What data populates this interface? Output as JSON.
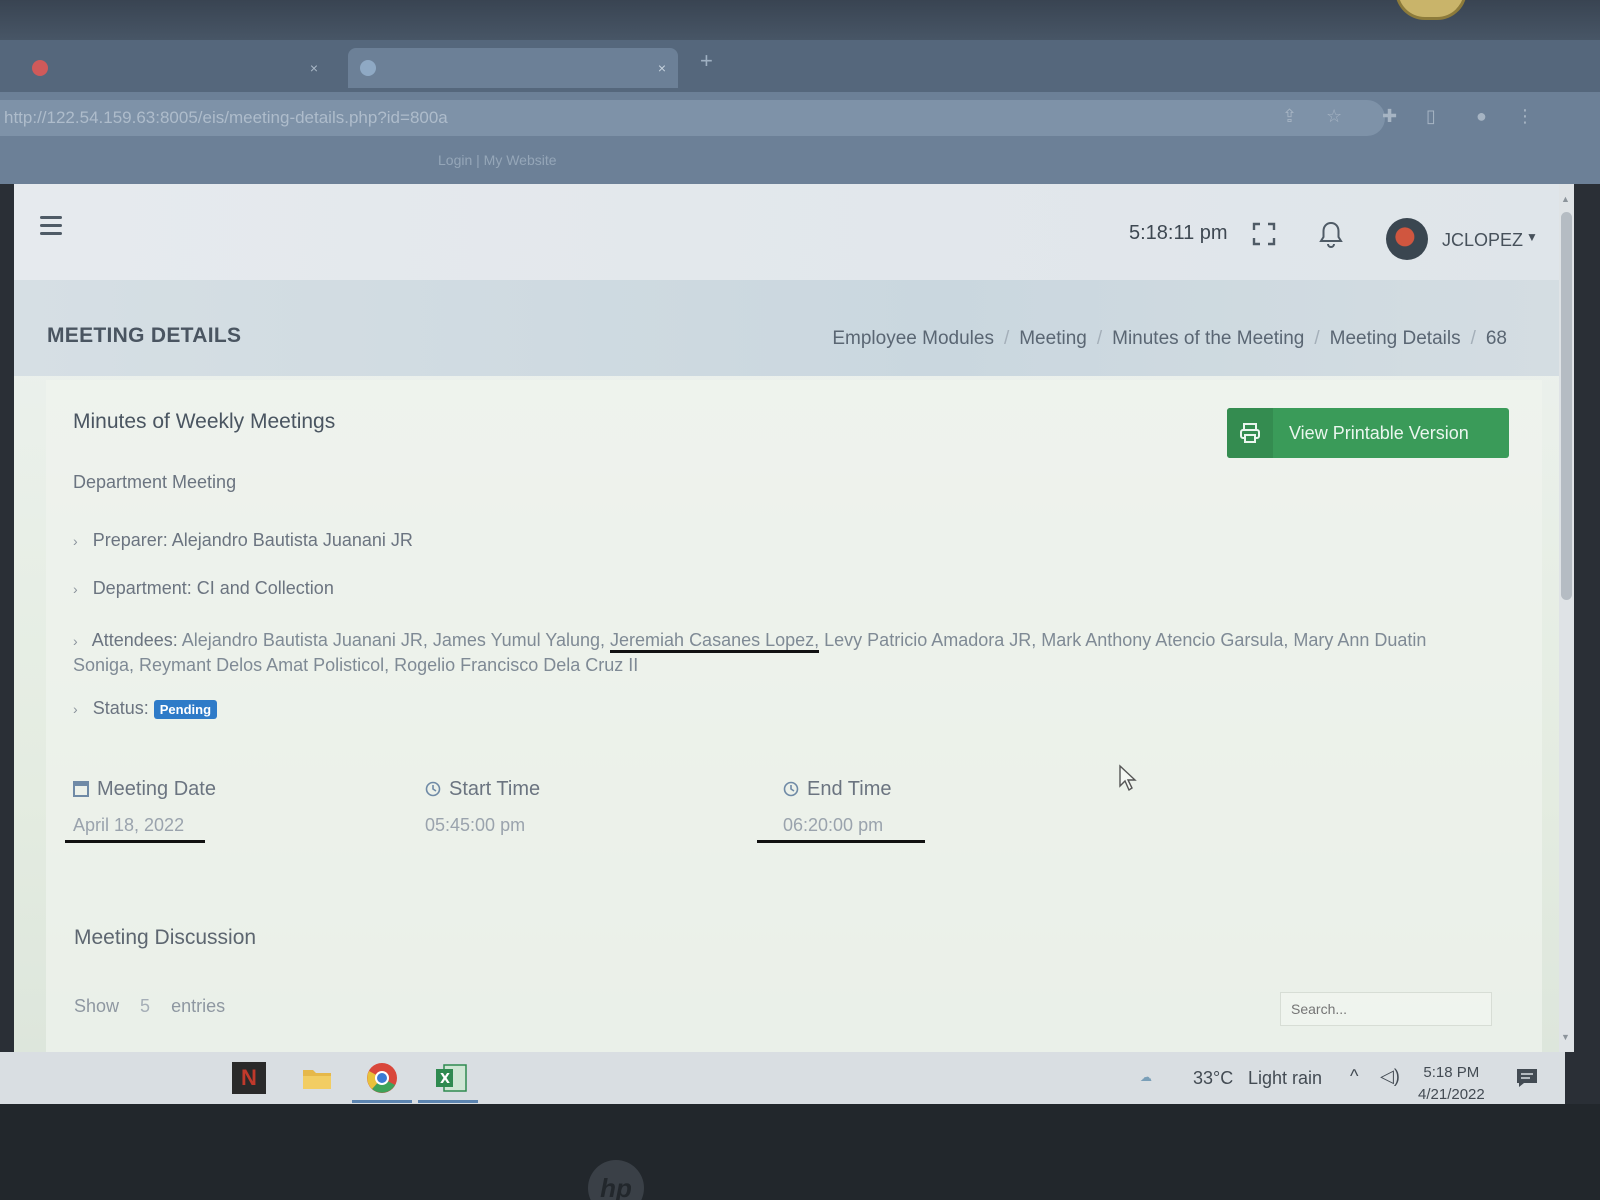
{
  "browser": {
    "tabs": [
      {
        "label": ""
      },
      {
        "label": ""
      }
    ],
    "url": "http://122.54.159.63:8005/eis/meeting-details.php?id=800a",
    "bookmarks": [
      "Login | My Website"
    ]
  },
  "header": {
    "time": "5:18:11 pm",
    "username": "JCLOPEZ"
  },
  "page_header": {
    "title": "MEETING DETAILS",
    "breadcrumb": [
      "Employee Modules",
      "Meeting",
      "Minutes of the Meeting",
      "Meeting Details",
      "68"
    ]
  },
  "card": {
    "title": "Minutes of Weekly Meetings",
    "subtitle": "Department Meeting",
    "print_button": "View Printable Version",
    "preparer_label": "Preparer:",
    "preparer": "Alejandro Bautista Juanani JR",
    "department_label": "Department:",
    "department": "CI and Collection",
    "attendees_label": "Attendees:",
    "attendees_before": "Alejandro Bautista Juanani JR, James Yumul Yalung, ",
    "attendees_marked": "Jeremiah Casanes Lopez,",
    "attendees_after": " Levy Patricio Amadora JR, Mark Anthony Atencio Garsula, Mary Ann Duatin Soniga, Reymant Delos Amat Polisticol, Rogelio Francisco Dela Cruz II",
    "status_label": "Status:",
    "status": "Pending",
    "meeting_date_label": "Meeting Date",
    "meeting_date": "April 18, 2022",
    "start_time_label": "Start Time",
    "start_time": "05:45:00 pm",
    "end_time_label": "End Time",
    "end_time": "06:20:00 pm",
    "discussion_title": "Meeting Discussion",
    "show_label": "Show",
    "entries_count": "5",
    "entries_label": "entries",
    "search_placeholder": "Search..."
  },
  "taskbar": {
    "temperature": "33°C",
    "weather": "Light rain",
    "time": "5:18 PM",
    "date": "4/21/2022"
  },
  "colors": {
    "accent_green": "#3a9b59",
    "badge_blue": "#2e7bc8"
  }
}
